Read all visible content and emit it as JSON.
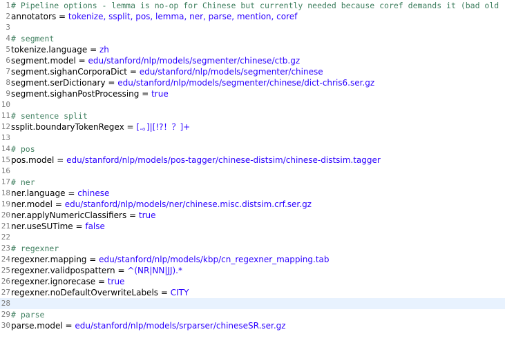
{
  "editor": {
    "current_line": 28,
    "lines": [
      {
        "n": "1",
        "type": "comment",
        "text": "# Pipeline options - lemma is no-op for Chinese but currently needed because coref demands it (bad old"
      },
      {
        "n": "2",
        "type": "kv",
        "key": "annotators",
        "value": "tokenize, ssplit, pos, lemma, ner, parse, mention, coref"
      },
      {
        "n": "3",
        "type": "blank"
      },
      {
        "n": "4",
        "type": "comment",
        "text": "# segment"
      },
      {
        "n": "5",
        "type": "kv",
        "key": "tokenize.language",
        "value": "zh"
      },
      {
        "n": "6",
        "type": "kv",
        "key": "segment.model",
        "value": "edu/stanford/nlp/models/segmenter/chinese/ctb.gz"
      },
      {
        "n": "7",
        "type": "kv",
        "key": "segment.sighanCorporaDict",
        "value": "edu/stanford/nlp/models/segmenter/chinese"
      },
      {
        "n": "8",
        "type": "kv",
        "key": "segment.serDictionary",
        "value": "edu/stanford/nlp/models/segmenter/chinese/dict-chris6.ser.gz"
      },
      {
        "n": "9",
        "type": "kv",
        "key": "segment.sighanPostProcessing",
        "value": "true"
      },
      {
        "n": "10",
        "type": "blank"
      },
      {
        "n": "11",
        "type": "comment",
        "text": "# sentence split"
      },
      {
        "n": "12",
        "type": "kv",
        "key": "ssplit.boundaryTokenRegex",
        "value": "[.。]|[!?！？]+"
      },
      {
        "n": "13",
        "type": "blank"
      },
      {
        "n": "14",
        "type": "comment",
        "text": "# pos"
      },
      {
        "n": "15",
        "type": "kv",
        "key": "pos.model",
        "value": "edu/stanford/nlp/models/pos-tagger/chinese-distsim/chinese-distsim.tagger"
      },
      {
        "n": "16",
        "type": "blank"
      },
      {
        "n": "17",
        "type": "comment",
        "text": "# ner"
      },
      {
        "n": "18",
        "type": "kv",
        "key": "ner.language",
        "value": "chinese"
      },
      {
        "n": "19",
        "type": "kv",
        "key": "ner.model",
        "value": "edu/stanford/nlp/models/ner/chinese.misc.distsim.crf.ser.gz"
      },
      {
        "n": "20",
        "type": "kv",
        "key": "ner.applyNumericClassifiers",
        "value": "true"
      },
      {
        "n": "21",
        "type": "kv",
        "key": "ner.useSUTime",
        "value": "false"
      },
      {
        "n": "22",
        "type": "blank"
      },
      {
        "n": "23",
        "type": "comment",
        "text": "# regexner"
      },
      {
        "n": "24",
        "type": "kv",
        "key": "regexner.mapping",
        "value": "edu/stanford/nlp/models/kbp/cn_regexner_mapping.tab"
      },
      {
        "n": "25",
        "type": "kv",
        "key": "regexner.validpospattern",
        "value": "^(NR|NN|JJ).*"
      },
      {
        "n": "26",
        "type": "kv",
        "key": "regexner.ignorecase",
        "value": "true"
      },
      {
        "n": "27",
        "type": "kv",
        "key": "regexner.noDefaultOverwriteLabels",
        "value": "CITY"
      },
      {
        "n": "28",
        "type": "blank"
      },
      {
        "n": "29",
        "type": "comment",
        "text": "# parse"
      },
      {
        "n": "30",
        "type": "kv",
        "key": "parse.model",
        "value": "edu/stanford/nlp/models/srparser/chineseSR.ser.gz"
      }
    ]
  }
}
